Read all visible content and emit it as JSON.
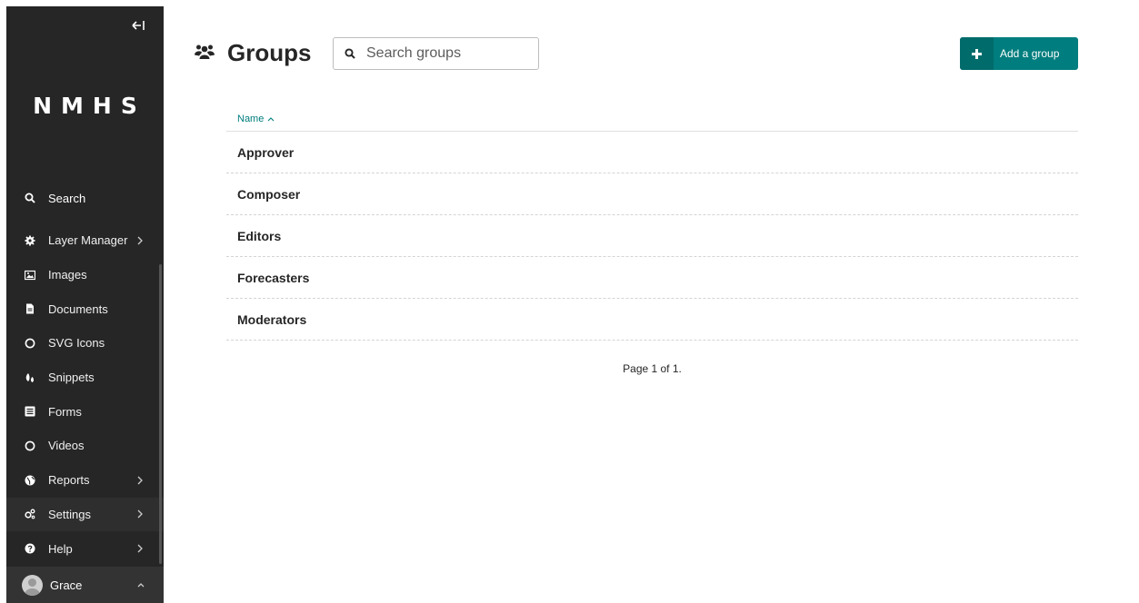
{
  "sidebar": {
    "logo": "NMHS",
    "search_label": "Search",
    "items": [
      {
        "label": "Layer Manager",
        "icon": "gear-icon",
        "chevron": true
      },
      {
        "label": "Images",
        "icon": "image-icon",
        "chevron": false
      },
      {
        "label": "Documents",
        "icon": "document-icon",
        "chevron": false
      },
      {
        "label": "SVG Icons",
        "icon": "circle-icon",
        "chevron": false
      },
      {
        "label": "Snippets",
        "icon": "snippet-icon",
        "chevron": false
      },
      {
        "label": "Forms",
        "icon": "form-icon",
        "chevron": false
      },
      {
        "label": "Videos",
        "icon": "circle-icon",
        "chevron": false
      },
      {
        "label": "Reports",
        "icon": "globe-icon",
        "chevron": true
      },
      {
        "label": "Settings",
        "icon": "cogs-icon",
        "chevron": true
      },
      {
        "label": "Help",
        "icon": "help-icon",
        "chevron": true
      }
    ],
    "user": {
      "name": "Grace"
    }
  },
  "header": {
    "title": "Groups",
    "search_placeholder": "Search groups",
    "add_label": "Add a group"
  },
  "table": {
    "column_name": "Name",
    "rows": [
      "Approver",
      "Composer",
      "Editors",
      "Forecasters",
      "Moderators"
    ]
  },
  "pagination": "Page 1 of 1.",
  "colors": {
    "sidebar_bg": "#262626",
    "accent": "#007d7e",
    "accent_dark": "#006b6b"
  }
}
